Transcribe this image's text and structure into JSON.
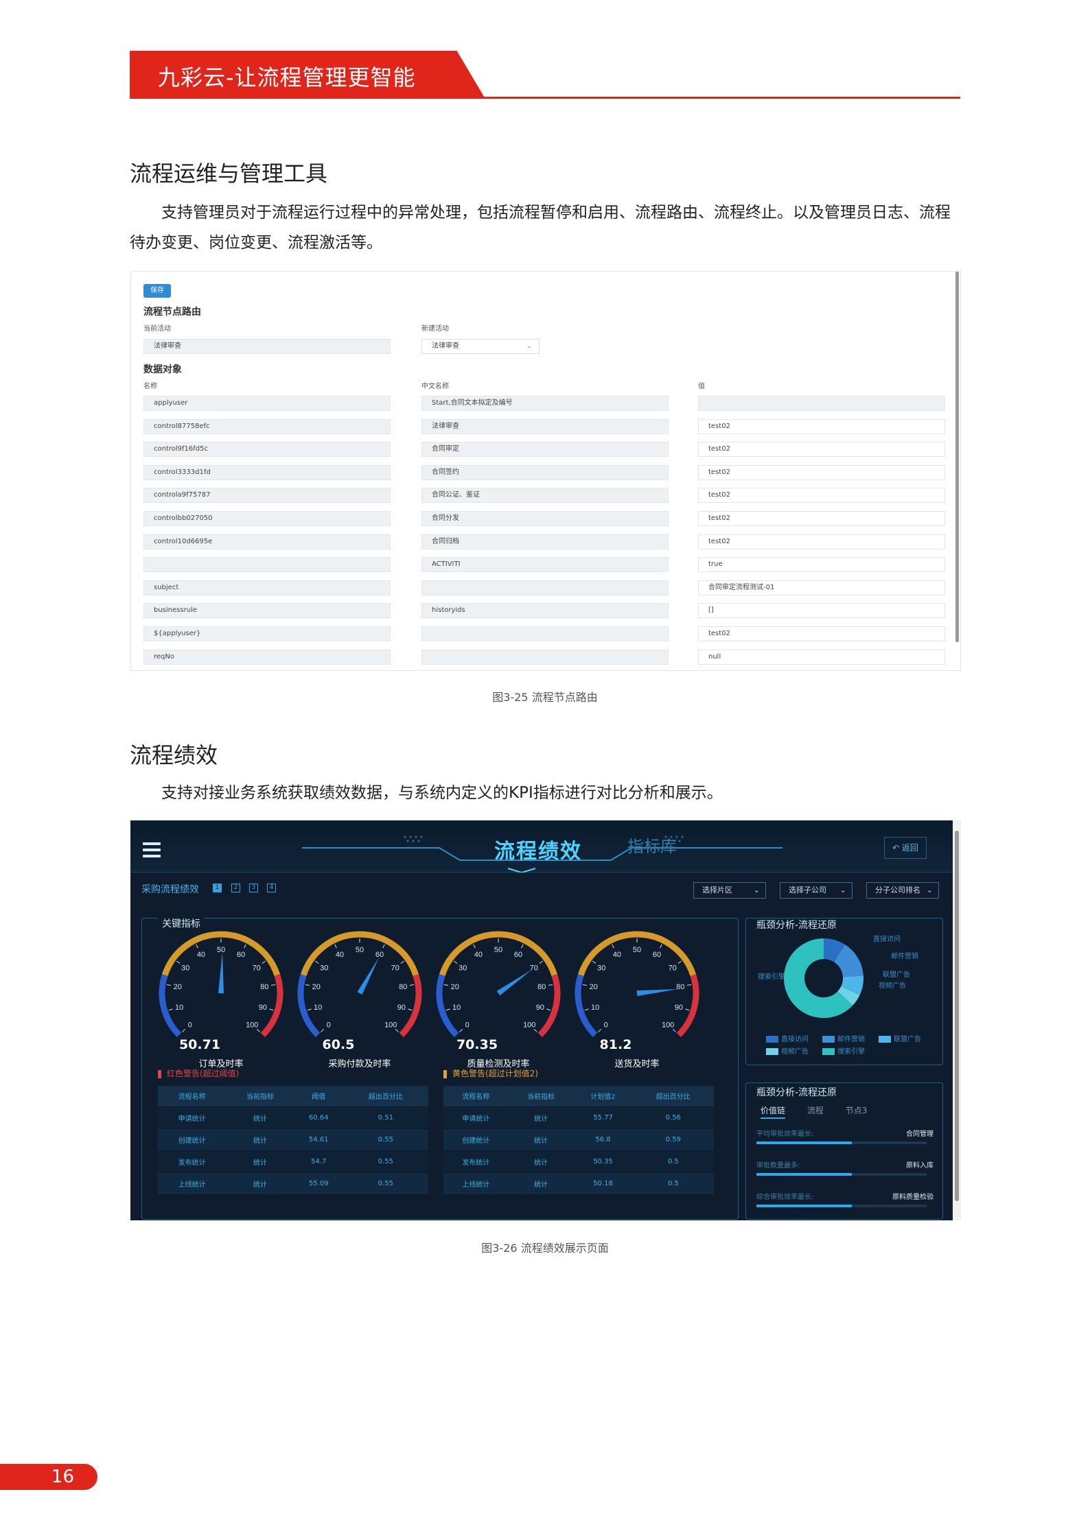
{
  "header": {
    "title": "九彩云-让流程管理更智能"
  },
  "section1": {
    "title": "流程运维与管理工具",
    "body": "支持管理员对于流程运行过程中的异常处理，包括流程暂停和启用、流程路由、流程终止。以及管理员日志、流程待办变更、岗位变更、流程激活等。"
  },
  "shot1": {
    "save": "保存",
    "route_title": "流程节点路由",
    "current_label": "当前活动",
    "new_label": "新建活动",
    "current_value": "法律审查",
    "new_value": "法律审查",
    "data_title": "数据对象",
    "col_name": "名称",
    "col_cn": "中文名称",
    "col_val": "值",
    "rows": [
      {
        "name": "applyuser",
        "cn": "Start,合同文本拟定及编号",
        "val": ""
      },
      {
        "name": "control87758efc",
        "cn": "法律审查",
        "val": "test02"
      },
      {
        "name": "control9f16fd5c",
        "cn": "合同审定",
        "val": "test02"
      },
      {
        "name": "control3333d1fd",
        "cn": "合同签约",
        "val": "test02"
      },
      {
        "name": "controla9f75787",
        "cn": "合同公证、鉴证",
        "val": "test02"
      },
      {
        "name": "controlbb027050",
        "cn": "合同分发",
        "val": "test02"
      },
      {
        "name": "control10d6695e",
        "cn": "合同归档",
        "val": "test02"
      },
      {
        "name": "",
        "cn": "ACTIVITI",
        "val": "true"
      },
      {
        "name": "subject",
        "cn": "",
        "val": "合同审定流程测试-01"
      },
      {
        "name": "businessrule",
        "cn": "historyids",
        "val": "[]"
      },
      {
        "name": "${applyuser}",
        "cn": "",
        "val": "test02"
      },
      {
        "name": "reqNo",
        "cn": "",
        "val": "null"
      }
    ]
  },
  "caption1": "图3-25 流程节点路由",
  "section2": {
    "title": "流程绩效",
    "body": "支持对接业务系统获取绩效数据，与系统内定义的KPI指标进行对比分析和展示。"
  },
  "shot2": {
    "title": "流程绩效",
    "tab": "指标库",
    "back": "返回",
    "subtitle": "采购流程绩效",
    "pages": [
      "1",
      "2",
      "3",
      "4"
    ],
    "dropdowns": [
      "选择片区",
      "选择子公司",
      "分子公司排名"
    ],
    "kpi_title": "关键指标",
    "gauges": [
      {
        "value": 50.71,
        "label": "订单及时率"
      },
      {
        "value": 60.5,
        "label": "采购付款及时率"
      },
      {
        "value": 70.35,
        "label": "质量检测及时率"
      },
      {
        "value": 81.2,
        "label": "送货及时率"
      }
    ],
    "gauge_ticks": [
      "0",
      "10",
      "20",
      "30",
      "40",
      "50",
      "60",
      "70",
      "80",
      "90",
      "100"
    ],
    "warn_red": "红色警告(超过阈值)",
    "warn_yellow": "黄色警告(超过计划值2)",
    "table_red": {
      "headers": [
        "流程名称",
        "当前指标",
        "阈值",
        "超出百分比"
      ],
      "rows": [
        [
          "申请统计",
          "统计",
          "60.64",
          "0.51"
        ],
        [
          "创建统计",
          "统计",
          "54.61",
          "0.55"
        ],
        [
          "发布统计",
          "统计",
          "54.7",
          "0.55"
        ],
        [
          "上线统计",
          "统计",
          "55.09",
          "0.55"
        ]
      ]
    },
    "table_yellow": {
      "headers": [
        "流程名称",
        "当前指标",
        "计划值2",
        "超出百分比"
      ],
      "rows": [
        [
          "申请统计",
          "统计",
          "55.77",
          "0.56"
        ],
        [
          "创建统计",
          "统计",
          "56.8",
          "0.59"
        ],
        [
          "发布统计",
          "统计",
          "50.35",
          "0.5"
        ],
        [
          "上线统计",
          "统计",
          "50.18",
          "0.5"
        ]
      ]
    },
    "pie_title": "瓶颈分析-流程还原",
    "pie_labels": [
      "直接访问",
      "邮件营销",
      "联盟广告",
      "视频广告",
      "搜索引擎"
    ],
    "pie_colors": [
      "#2a70c4",
      "#3e8ed8",
      "#4fb6ea",
      "#6fd2e6",
      "#2fc0c0"
    ],
    "legend": [
      "直接访问",
      "邮件营销",
      "联盟广告",
      "视频广告",
      "搜索引擎"
    ],
    "chain_title": "瓶颈分析-流程还原",
    "chain_tabs": [
      "价值链",
      "流程",
      "节点3"
    ],
    "chain_rows": [
      {
        "name": "平均审批效率最长:",
        "value": "合同管理"
      },
      {
        "name": "审批数量最多:",
        "value": "原料入库"
      },
      {
        "name": "综合审批效率最长:",
        "value": "原料质量检验"
      }
    ]
  },
  "caption2": "图3-26 流程绩效展示页面",
  "page_number": "16"
}
